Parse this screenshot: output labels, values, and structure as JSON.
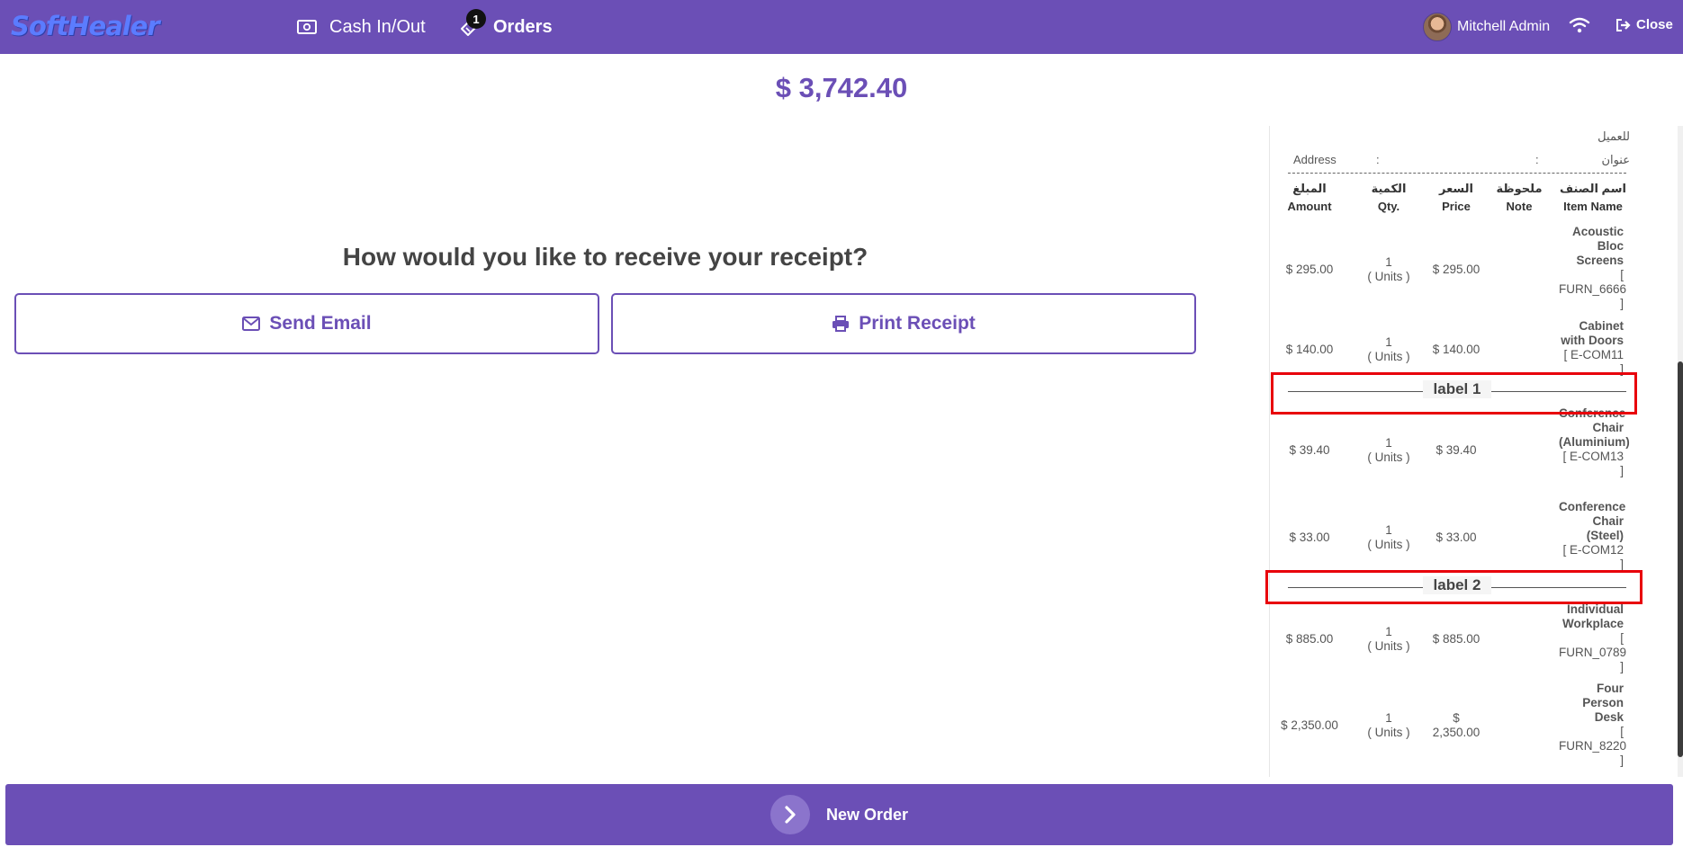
{
  "topbar": {
    "logo": "SoftHealer",
    "cash_label": "Cash In/Out",
    "orders_label": "Orders",
    "orders_badge": "1",
    "user_name": "Mitchell Admin",
    "close_label": "Close"
  },
  "total": "$ 3,742.40",
  "receipt_prompt": {
    "question": "How would you like to receive your receipt?",
    "email_label": "Send Email",
    "print_label": "Print Receipt"
  },
  "receipt": {
    "customer_label_ar": "للعميل",
    "address_label_ar": "عنوان",
    "address_label": "Address",
    "colon1": ":",
    "colon2": ":",
    "headers": {
      "amount_ar": "المبلغ",
      "amount": "Amount",
      "qty_ar": "الكمية",
      "qty": "Qty.",
      "price_ar": "السعر",
      "price": "Price",
      "note_ar": "ملحوظة",
      "note": "Note",
      "item_ar": "اسم الصنف",
      "item": "Item Name"
    },
    "lines": [
      {
        "amount": "$ 295.00",
        "qty": "1",
        "unit": "( Units )",
        "price": "$ 295.00",
        "name": "Acoustic Bloc Screens",
        "code": "[ FURN_6666 ]"
      },
      {
        "amount": "$ 140.00",
        "qty": "1",
        "unit": "( Units )",
        "price": "$ 140.00",
        "name": "Cabinet with Doors",
        "code": "[ E-COM11 ]"
      },
      {
        "amount": "$ 39.40",
        "qty": "1",
        "unit": "( Units )",
        "price": "$ 39.40",
        "name": "Conference Chair (Aluminium)",
        "code": "[ E-COM13 ]"
      },
      {
        "amount": "$ 33.00",
        "qty": "1",
        "unit": "( Units )",
        "price": "$ 33.00",
        "name": "Conference Chair (Steel)",
        "code": "[ E-COM12 ]"
      },
      {
        "amount": "$ 885.00",
        "qty": "1",
        "unit": "( Units )",
        "price": "$ 885.00",
        "name": "Individual Workplace",
        "code": "[ FURN_0789 ]"
      },
      {
        "amount": "$ 2,350.00",
        "qty": "1",
        "unit": "( Units )",
        "price": "$ 2,350.00",
        "name": "Four Person Desk",
        "code": "[ FURN_8220 ]"
      }
    ],
    "labels": [
      "label 1",
      "label 2"
    ]
  },
  "bottom": {
    "new_order_label": "New Order"
  },
  "colors": {
    "primary": "#6b4fb6",
    "highlight": "#e8000b"
  }
}
